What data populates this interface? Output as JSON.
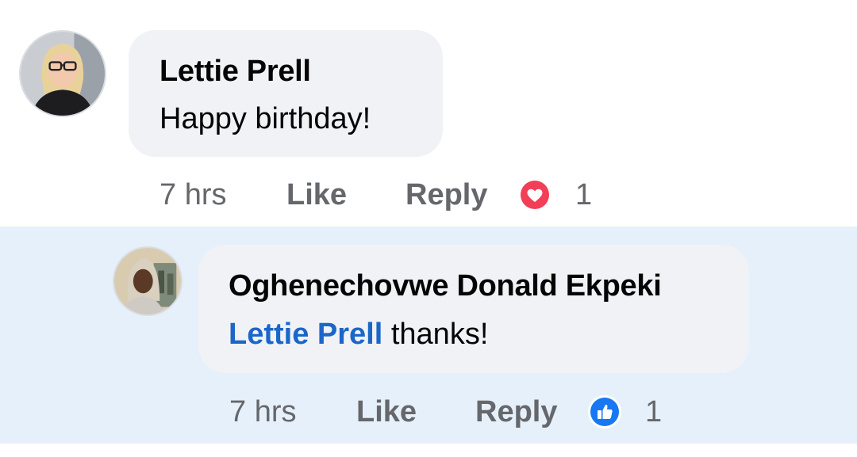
{
  "comments": [
    {
      "author": "Lettie Prell",
      "text": "Happy birthday!",
      "time": "7 hrs",
      "like_label": "Like",
      "reply_label": "Reply",
      "reaction": "heart-reaction-icon",
      "reaction_count": "1"
    },
    {
      "author": "Oghenechovwe Donald Ekpeki",
      "mention": "Lettie Prell",
      "text": " thanks!",
      "time": "7 hrs",
      "like_label": "Like",
      "reply_label": "Reply",
      "reaction": "thumbs-up-reaction-icon",
      "reaction_count": "1"
    }
  ],
  "colors": {
    "bubble": "#f0f2f5",
    "reply_highlight": "#e6f0fb",
    "mention": "#1b66c9",
    "meta_text": "#65676b",
    "love": "#f33e58",
    "like": "#1877f2"
  }
}
